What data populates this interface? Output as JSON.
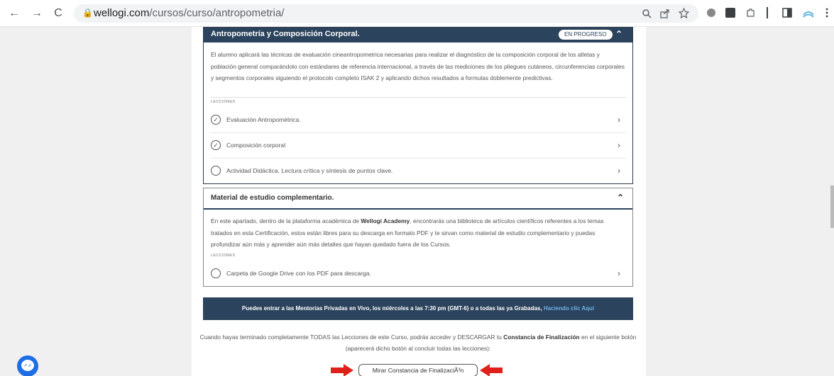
{
  "browser": {
    "url_host": "wellogi.com",
    "url_path": "/cursos/curso/antropometria/",
    "back": "←",
    "forward": "→",
    "reload": "C",
    "lock": "🔒"
  },
  "course": {
    "title": "Antropometría y Composición Corporal.",
    "status": "EN PROGRESO",
    "collapse": "⌃",
    "description": "El alumno aplicará las técnicas de evaluación cineantropometrica necesarias para realizar el diagnóstico de la composición corporal de los atletas y población general comparándolo con estándares de referencia internacional, a través de las mediciones de los pliegues cutáneos, circunferencias corporales y segmentos corporales siguiendo el protocolo completo ISAK 2 y aplicando dichos resultados a formulas doblemente predictivas.",
    "lessons_label": "LECCIONES",
    "lessons": [
      {
        "title": "Evaluación Antropométrica.",
        "done": "✓"
      },
      {
        "title": "Composición corporal",
        "done": "✓"
      },
      {
        "title": "Actividad Didáctica. Lectura crítica y síntesis de puntos clave.",
        "done": ""
      }
    ]
  },
  "material": {
    "title": "Material de estudio complementario.",
    "collapse": "⌃",
    "desc_pre": "En este apartado, dentro de la plataforma académica de ",
    "desc_bold": "Wellogi Academy",
    "desc_post": ", encontrarás una biblioteca de artículos científicos referentes a los temas tratados en esta Certificación, estos están libres para su descarga en formato PDF y te sirvan como material de estudio complementario y puedas profundizar aún más y aprender aún más detalles que hayan quedado fuera de los Cursos.",
    "lessons_label": "LECCIONES",
    "lesson": "Carpeta de Google Drive con los PDF para descarga."
  },
  "banner": {
    "text": "Puedes entrar a las Mentorías Privadas en Vivo, los miércoles a las 7:30 pm (GMT-6) o a todas las ya Grabadas, ",
    "link": "Haciendo clic Aquí"
  },
  "final": {
    "pre": "Cuando hayas terminado completamente TODAS las Lecciones de este Curso, podrás acceder y DESCARGAR tu ",
    "bold": "Constancia de Finalización",
    "post": " en el siguiente botón (aparecerá dicho botón al concluir todas las lecciones):",
    "button": "Mirar Constancia de FinalizaciÃ³n"
  },
  "lesson_chevron": "›",
  "colors": {
    "header": "#2b435c",
    "arrow": "#e0201a",
    "messenger": "#1d6de5",
    "link": "#6fb1e8"
  }
}
